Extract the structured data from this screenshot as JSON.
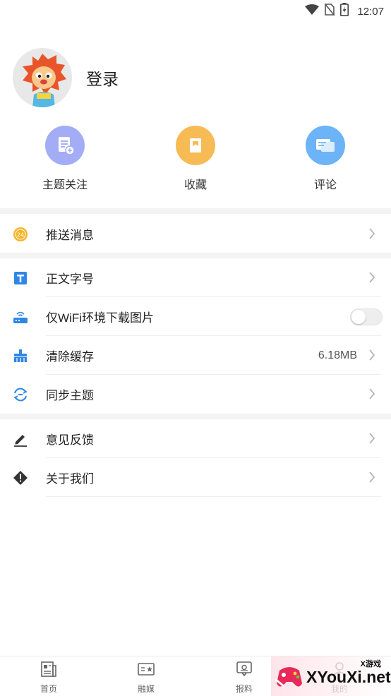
{
  "status_bar": {
    "time": "12:07",
    "icons": [
      "wifi-icon",
      "no-sim-icon",
      "battery-icon"
    ]
  },
  "profile": {
    "avatar_icon": "lion-mascot-avatar",
    "login_label": "登录"
  },
  "quick_actions": [
    {
      "icon": "document-add-icon",
      "label": "主题关注",
      "color": "#9aa6f5"
    },
    {
      "icon": "bookmark-icon",
      "label": "收藏",
      "color": "#f7b955"
    },
    {
      "icon": "comment-icon",
      "label": "评论",
      "color": "#6ab1f7"
    }
  ],
  "menu_groups": [
    {
      "items": [
        {
          "icon": "push-24-icon",
          "label": "推送消息"
        }
      ]
    },
    {
      "items": [
        {
          "icon": "text-size-icon",
          "label": "正文字号"
        },
        {
          "icon": "router-icon",
          "label": "仅WiFi环境下载图片",
          "toggle": false
        },
        {
          "icon": "broom-icon",
          "label": "清除缓存",
          "value": "6.18MB"
        },
        {
          "icon": "sync-icon",
          "label": "同步主题"
        }
      ]
    },
    {
      "items": [
        {
          "icon": "pencil-icon",
          "label": "意见反馈"
        },
        {
          "icon": "warning-diamond-icon",
          "label": "关于我们"
        }
      ]
    }
  ],
  "tabbar": {
    "tabs": [
      {
        "icon": "home-news-icon",
        "label": "首页"
      },
      {
        "icon": "media-icon",
        "label": "融媒"
      },
      {
        "icon": "report-icon",
        "label": "报料"
      },
      {
        "icon": "me-icon",
        "label": "我的"
      }
    ]
  },
  "watermark": {
    "small_text": "X游戏",
    "text": "XYouXi.net"
  },
  "colors": {
    "accent_push": "#f6b429",
    "icon_blue": "#2f86e6",
    "chevron": "#b5b5b5"
  }
}
